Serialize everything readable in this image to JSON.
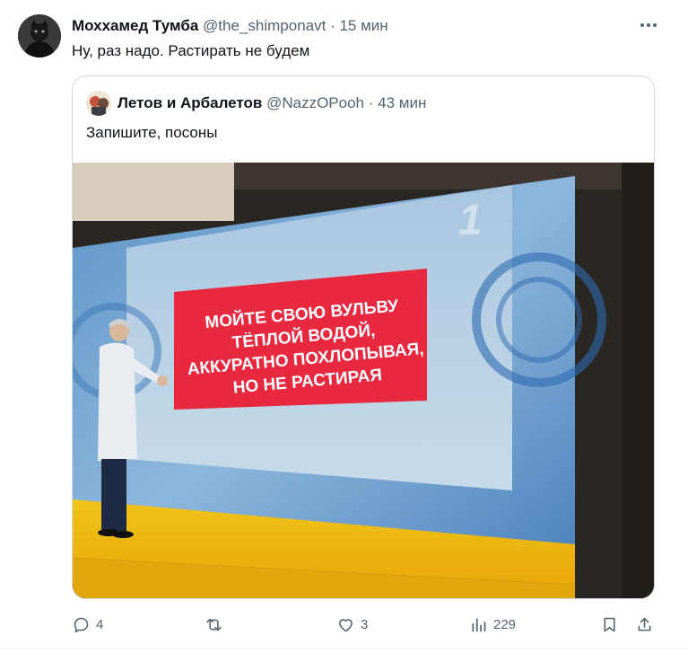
{
  "tweet": {
    "author_name": "Моххамед Тумба",
    "handle": "@the_shimponavt",
    "separator": "·",
    "time": "15 мин",
    "text": "Ну, раз надо. Растирать не будем"
  },
  "quote": {
    "author_name": "Летов и Арбалетов",
    "handle": "@NazzOPooh",
    "separator": "·",
    "time": "43 мин",
    "text": "Запишите, посоны",
    "image": {
      "screen_text": [
        "МОЙТЕ СВОЮ ВУЛЬВУ",
        "ТЁПЛОЙ ВОДОЙ,",
        "АККУРАТНО ПОХЛОПЫВАЯ,",
        "НО НЕ РАСТИРАЯ"
      ],
      "watermark": "Двач",
      "channel_logo": "1"
    }
  },
  "actions": {
    "replies": "4",
    "retweets": "",
    "likes": "3",
    "views": "229"
  },
  "icons": [
    "more-icon",
    "reply-icon",
    "retweet-icon",
    "like-icon",
    "views-icon",
    "bookmark-icon",
    "share-icon"
  ],
  "colors": {
    "text": "#0f1419",
    "secondary": "#536471",
    "border": "#cfd9de",
    "screen_red": "#e8283e"
  }
}
